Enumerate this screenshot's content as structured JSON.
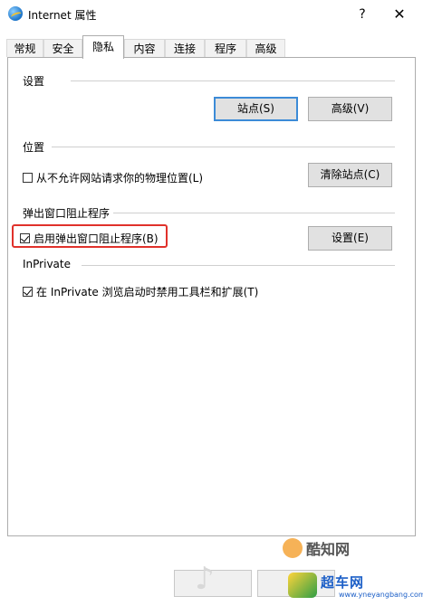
{
  "window": {
    "title": "Internet 属性",
    "help": "?",
    "close": "✕"
  },
  "tabs": [
    "常规",
    "安全",
    "隐私",
    "内容",
    "连接",
    "程序",
    "高级"
  ],
  "active_tab": "隐私",
  "settings": {
    "label": "设置",
    "sites_button": "站点(S)",
    "advanced_button": "高级(V)"
  },
  "location": {
    "label": "位置",
    "never_allow_checkbox": "从不允许网站请求你的物理位置(L)",
    "never_allow_checked": false,
    "clear_sites_button": "清除站点(C)"
  },
  "popup_blocker": {
    "label": "弹出窗口阻止程序",
    "enable_checkbox": "启用弹出窗口阻止程序(B)",
    "enable_checked": true,
    "settings_button": "设置(E)"
  },
  "inprivate": {
    "label": "InPrivate",
    "disable_toolbars_checkbox": "在 InPrivate 浏览启动时禁用工具栏和扩展(T)",
    "disable_toolbars_checked": true
  },
  "watermarks": {
    "brand1": "酷知网",
    "brand2": "超车网",
    "brand2_url": "www.yneyangbang.com"
  },
  "colors": {
    "highlight": "#e0312b",
    "default_button_border": "#3c8bd7"
  }
}
